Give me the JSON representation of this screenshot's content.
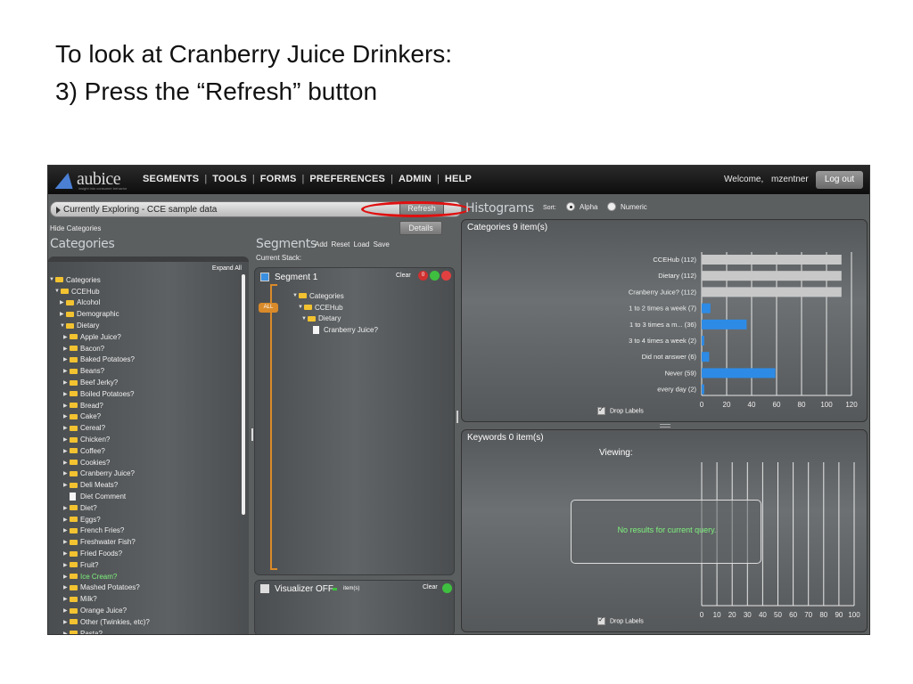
{
  "slide": {
    "line1": "To look at Cranberry Juice Drinkers:",
    "line2": "3) Press the “Refresh” button"
  },
  "app": {
    "logo_text": "aubice",
    "logo_tagline": "insight into consumer behavior",
    "nav": [
      "SEGMENTS",
      "TOOLS",
      "FORMS",
      "PREFERENCES",
      "ADMIN",
      "HELP"
    ],
    "welcome": "Welcome,",
    "username": "mzentner",
    "logout": "Log out"
  },
  "explore": {
    "text": "Currently Exploring - CCE sample data",
    "refresh": "Refresh",
    "details": "Details",
    "hide_categories": "Hide Categories"
  },
  "categories": {
    "heading": "Categories",
    "expand_all": "Expand All",
    "tree": [
      {
        "label": "Categories",
        "type": "folder",
        "open": true
      },
      {
        "label": "CCEHub",
        "type": "folder",
        "open": true
      },
      {
        "label": "Alcohol",
        "type": "folder",
        "open": false
      },
      {
        "label": "Demographic",
        "type": "folder",
        "open": false
      },
      {
        "label": "Dietary",
        "type": "folder",
        "open": true
      },
      {
        "label": "Apple Juice?",
        "type": "folder",
        "open": false
      },
      {
        "label": "Bacon?",
        "type": "folder",
        "open": false
      },
      {
        "label": "Baked Potatoes?",
        "type": "folder",
        "open": false
      },
      {
        "label": "Beans?",
        "type": "folder",
        "open": false
      },
      {
        "label": "Beef Jerky?",
        "type": "folder",
        "open": false
      },
      {
        "label": "Boiled Potatoes?",
        "type": "folder",
        "open": false
      },
      {
        "label": "Bread?",
        "type": "folder",
        "open": false
      },
      {
        "label": "Cake?",
        "type": "folder",
        "open": false
      },
      {
        "label": "Cereal?",
        "type": "folder",
        "open": false
      },
      {
        "label": "Chicken?",
        "type": "folder",
        "open": false
      },
      {
        "label": "Coffee?",
        "type": "folder",
        "open": false
      },
      {
        "label": "Cookies?",
        "type": "folder",
        "open": false
      },
      {
        "label": "Cranberry Juice?",
        "type": "folder",
        "open": false
      },
      {
        "label": "Deli Meats?",
        "type": "folder",
        "open": false
      },
      {
        "label": "Diet Comment",
        "type": "doc",
        "open": false
      },
      {
        "label": "Diet?",
        "type": "folder",
        "open": false
      },
      {
        "label": "Eggs?",
        "type": "folder",
        "open": false
      },
      {
        "label": "French Fries?",
        "type": "folder",
        "open": false
      },
      {
        "label": "Freshwater Fish?",
        "type": "folder",
        "open": false
      },
      {
        "label": "Fried Foods?",
        "type": "folder",
        "open": false
      },
      {
        "label": "Fruit?",
        "type": "folder",
        "open": false
      },
      {
        "label": "Ice Cream?",
        "type": "folder",
        "open": false,
        "highlight": true
      },
      {
        "label": "Mashed Potatoes?",
        "type": "folder",
        "open": false
      },
      {
        "label": "Milk?",
        "type": "folder",
        "open": false
      },
      {
        "label": "Orange Juice?",
        "type": "folder",
        "open": false
      },
      {
        "label": "Other (Twinkies, etc)?",
        "type": "folder",
        "open": false
      },
      {
        "label": "Pasta?",
        "type": "folder",
        "open": false
      }
    ]
  },
  "segments": {
    "heading": "Segments",
    "links": "Add  Reset  Load  Save",
    "current_stack": "Current Stack:",
    "segment_title": "Segment 1",
    "clear": "Clear",
    "count": "0",
    "all": "ALL",
    "tree": [
      {
        "label": "Categories",
        "type": "folder",
        "open": true
      },
      {
        "label": "CCEHub",
        "type": "folder",
        "open": true
      },
      {
        "label": "Dietary",
        "type": "folder",
        "open": true
      },
      {
        "label": "Cranberry Juice?",
        "type": "doc",
        "open": false
      }
    ],
    "visualizer": "Visualizer OFF",
    "viz_items": "item(s)",
    "viz_clear": "Clear"
  },
  "histograms": {
    "heading": "Histograms",
    "sort_label": "Sort:",
    "sort_alpha": "Alpha",
    "sort_numeric": "Numeric",
    "categories_head": "Categories  9    item(s)",
    "keywords_head": "Keywords  0    item(s)",
    "drop_labels": "Drop Labels",
    "viewing": "Viewing:",
    "no_results": "No results for current query."
  },
  "chart_data": [
    {
      "type": "bar",
      "orientation": "horizontal",
      "categories": [
        "CCEHub (112)",
        "Dietary (112)",
        "Cranberry Juice? (112)",
        "1 to 2 times a week (7)",
        "1 to 3 times a m... (36)",
        "3 to 4 times a week (2)",
        "Did not answer (6)",
        "Never (59)",
        "every day (2)"
      ],
      "values": [
        112,
        112,
        112,
        7,
        36,
        2,
        6,
        59,
        2
      ],
      "bar_colors": [
        "#c8c8c8",
        "#c8c8c8",
        "#c8c8c8",
        "#2d8be6",
        "#2d8be6",
        "#2d8be6",
        "#2d8be6",
        "#2d8be6",
        "#2d8be6"
      ],
      "xlim": [
        0,
        120
      ],
      "xticks": [
        0,
        20,
        40,
        60,
        80,
        100,
        120
      ]
    },
    {
      "type": "bar",
      "orientation": "horizontal",
      "categories": [],
      "values": [],
      "xlim": [
        0,
        100
      ],
      "xticks": [
        0,
        10,
        20,
        30,
        40,
        50,
        60,
        70,
        80,
        90,
        100
      ]
    }
  ]
}
